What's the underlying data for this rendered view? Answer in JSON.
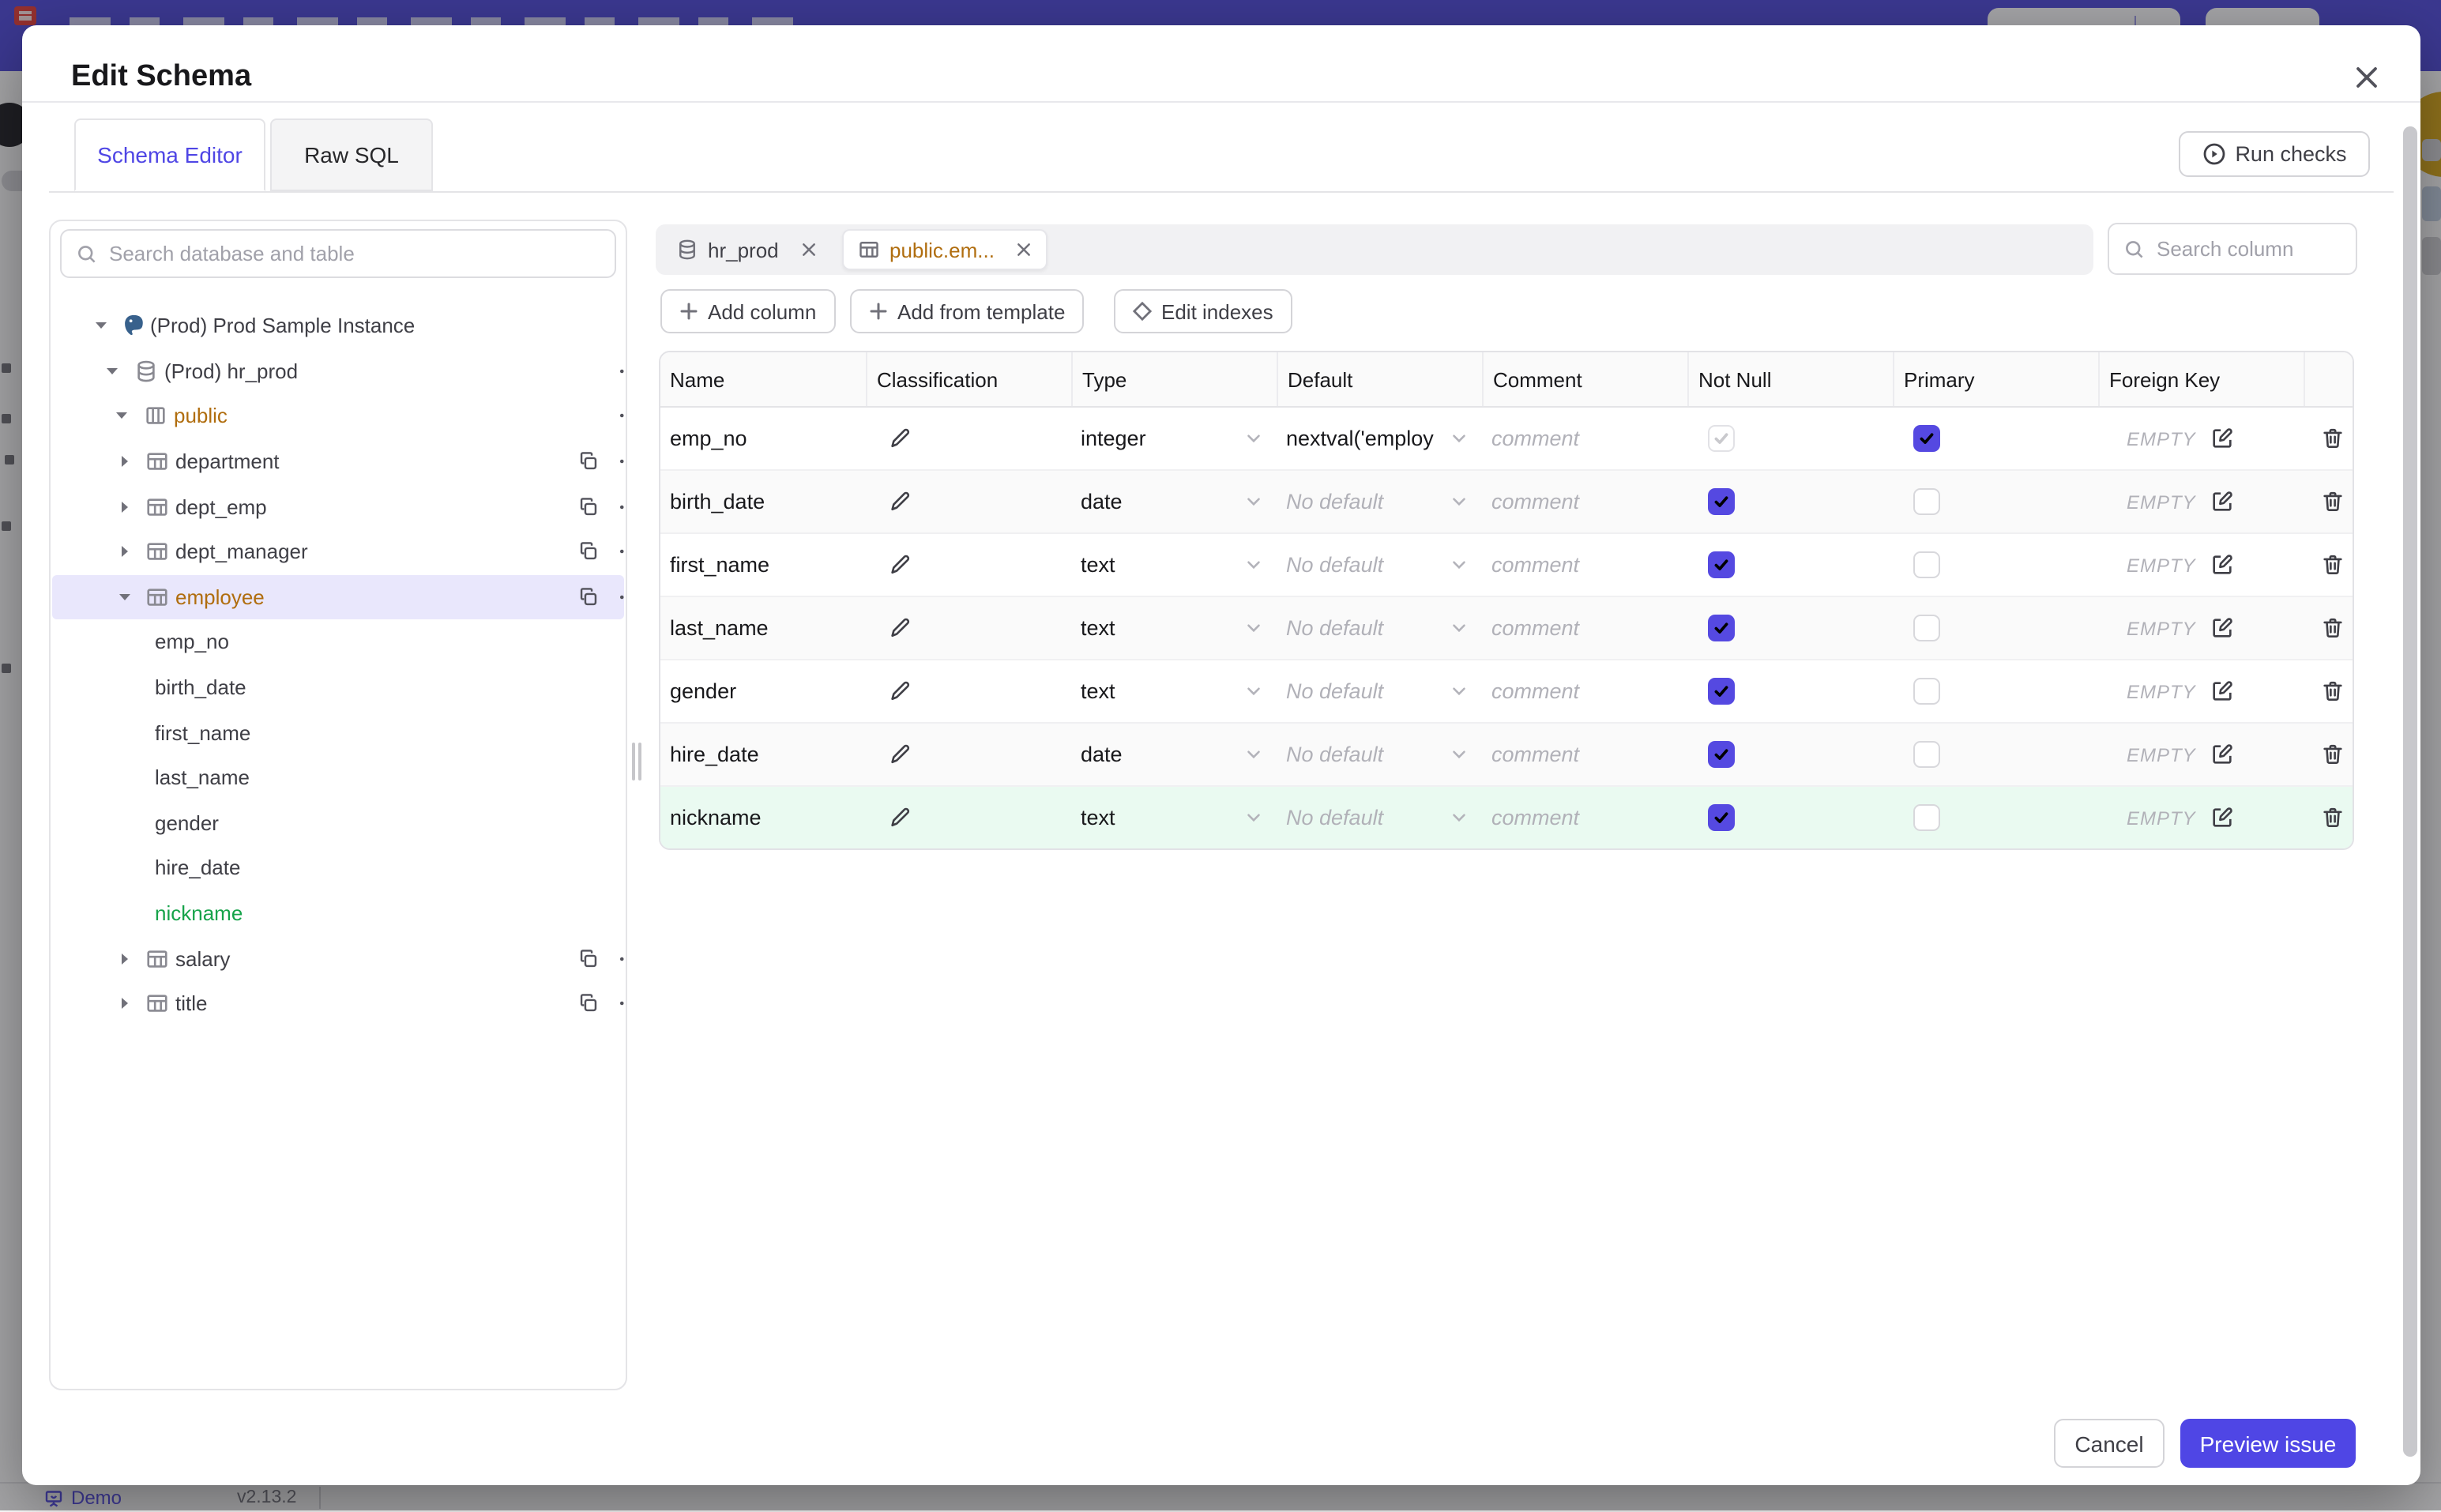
{
  "background": {
    "bottombar": {
      "demo_label": "Demo",
      "version": "v2.13.2"
    }
  },
  "modal": {
    "title": "Edit Schema",
    "tabs": [
      {
        "label": "Schema Editor",
        "active": true
      },
      {
        "label": "Raw SQL",
        "active": false
      }
    ],
    "run_checks_label": "Run checks",
    "sidebar": {
      "search_placeholder": "Search database and table",
      "tree": [
        {
          "label": "(Prod) Prod Sample Instance",
          "level": 0,
          "icon": "postgres",
          "expanded": true,
          "actions": []
        },
        {
          "label": "(Prod) hr_prod",
          "level": 1,
          "icon": "database",
          "expanded": true,
          "actions": [
            "more"
          ]
        },
        {
          "label": "public",
          "level": 2,
          "icon": "schema",
          "expanded": true,
          "color": "#b06d0e",
          "actions": [
            "more"
          ]
        },
        {
          "label": "department",
          "level": 3,
          "icon": "table",
          "expanded": false,
          "actions": [
            "copy",
            "more"
          ]
        },
        {
          "label": "dept_emp",
          "level": 3,
          "icon": "table",
          "expanded": false,
          "actions": [
            "copy",
            "more"
          ]
        },
        {
          "label": "dept_manager",
          "level": 3,
          "icon": "table",
          "expanded": false,
          "actions": [
            "copy",
            "more"
          ]
        },
        {
          "label": "employee",
          "level": 3,
          "icon": "table",
          "expanded": true,
          "color": "#b06d0e",
          "selected": true,
          "actions": [
            "copy",
            "more"
          ]
        },
        {
          "label": "emp_no",
          "level": 4,
          "actions": []
        },
        {
          "label": "birth_date",
          "level": 4,
          "actions": []
        },
        {
          "label": "first_name",
          "level": 4,
          "actions": []
        },
        {
          "label": "last_name",
          "level": 4,
          "actions": []
        },
        {
          "label": "gender",
          "level": 4,
          "actions": []
        },
        {
          "label": "hire_date",
          "level": 4,
          "actions": []
        },
        {
          "label": "nickname",
          "level": 4,
          "color": "#16a34a",
          "actions": []
        },
        {
          "label": "salary",
          "level": 3,
          "icon": "table",
          "expanded": false,
          "actions": [
            "copy",
            "more"
          ]
        },
        {
          "label": "title",
          "level": 3,
          "icon": "table",
          "expanded": false,
          "actions": [
            "copy",
            "more"
          ]
        }
      ]
    },
    "editor": {
      "open_tabs": [
        {
          "label": "hr_prod",
          "icon": "database",
          "active": false
        },
        {
          "label": "public.em...",
          "icon": "table",
          "active": true
        }
      ],
      "toolbar": [
        {
          "label": "Add column",
          "icon": "plus"
        },
        {
          "label": "Add from template",
          "icon": "plus"
        },
        {
          "label": "Edit indexes",
          "icon": "diamond"
        }
      ],
      "column_search_placeholder": "Search column",
      "table": {
        "headers": [
          "Name",
          "Classification",
          "Type",
          "Default",
          "Comment",
          "Not Null",
          "Primary",
          "Foreign Key"
        ],
        "comment_placeholder": "comment",
        "no_default_placeholder": "No default",
        "fk_empty_label": "EMPTY",
        "rows": [
          {
            "name": "emp_no",
            "type": "integer",
            "default": "nextval('employ",
            "not_null": {
              "checked": true,
              "disabled": true
            },
            "primary": {
              "checked": true
            },
            "shade": false,
            "green": false
          },
          {
            "name": "birth_date",
            "type": "date",
            "default": null,
            "not_null": {
              "checked": true,
              "disabled": false
            },
            "primary": {
              "checked": false
            },
            "shade": true,
            "green": false
          },
          {
            "name": "first_name",
            "type": "text",
            "default": null,
            "not_null": {
              "checked": true,
              "disabled": false
            },
            "primary": {
              "checked": false
            },
            "shade": false,
            "green": false
          },
          {
            "name": "last_name",
            "type": "text",
            "default": null,
            "not_null": {
              "checked": true,
              "disabled": false
            },
            "primary": {
              "checked": false
            },
            "shade": true,
            "green": false
          },
          {
            "name": "gender",
            "type": "text",
            "default": null,
            "not_null": {
              "checked": true,
              "disabled": false
            },
            "primary": {
              "checked": false
            },
            "shade": false,
            "green": false
          },
          {
            "name": "hire_date",
            "type": "date",
            "default": null,
            "not_null": {
              "checked": true,
              "disabled": false
            },
            "primary": {
              "checked": false
            },
            "shade": true,
            "green": false
          },
          {
            "name": "nickname",
            "type": "text",
            "default": null,
            "not_null": {
              "checked": true,
              "disabled": false
            },
            "primary": {
              "checked": false
            },
            "shade": false,
            "green": true
          }
        ]
      }
    },
    "footer": {
      "cancel_label": "Cancel",
      "primary_label": "Preview issue"
    },
    "colors": {
      "accent_indigo": "#4f46e5",
      "checkbox_indigo": "#5549e1",
      "entity_orange": "#b06d0e",
      "new_green_text": "#16a34a",
      "new_green_row_bg": "#eafaf1",
      "selected_row_bg": "#e9e7fc",
      "topbar_indigo": "#4743d6"
    }
  }
}
